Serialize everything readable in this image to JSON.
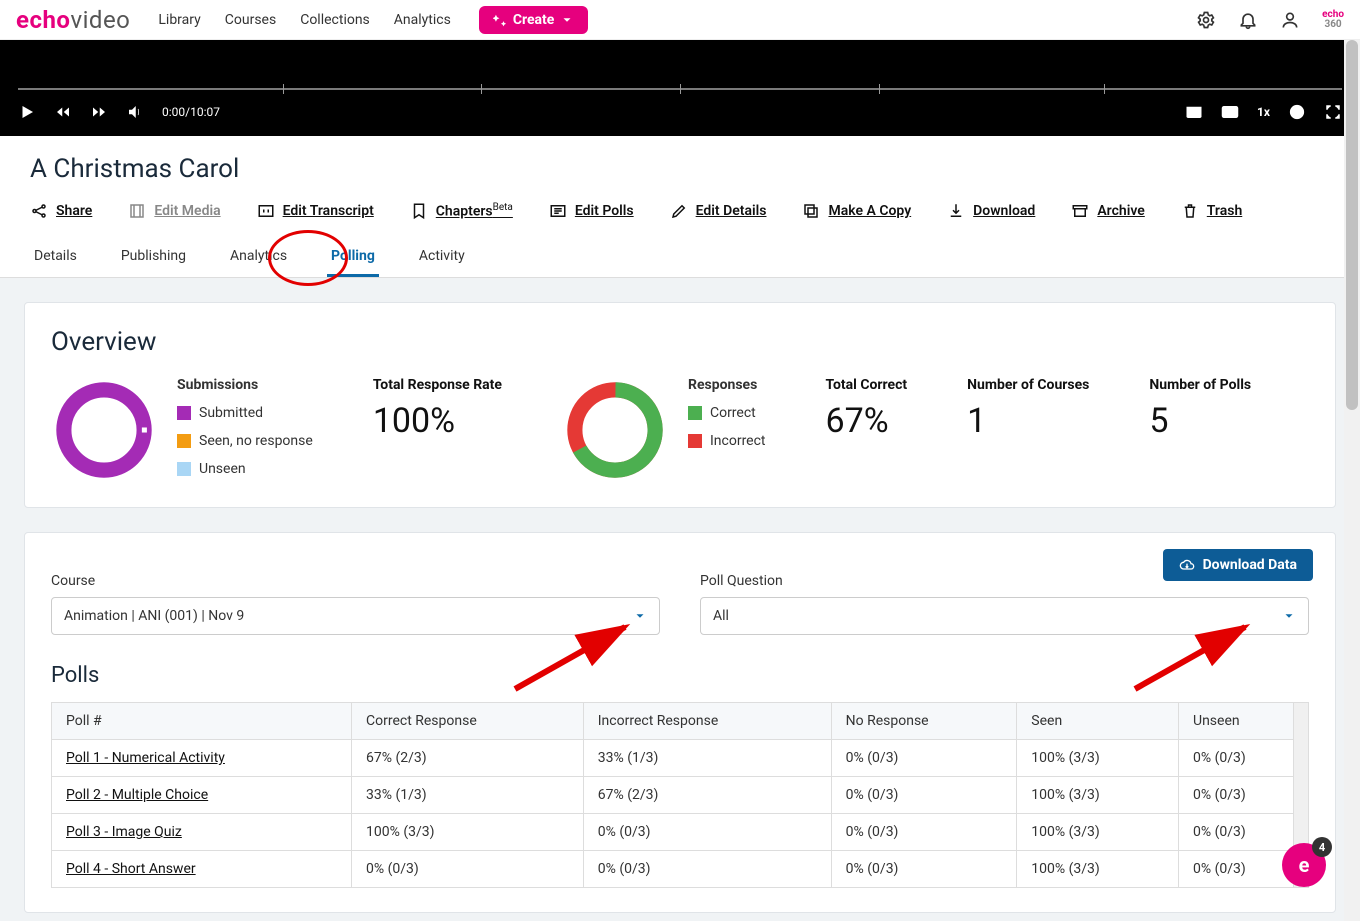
{
  "brand": {
    "name_a": "echo",
    "name_b": "video",
    "mini_a": "echo",
    "mini_b": "360"
  },
  "topnav": {
    "library": "Library",
    "courses": "Courses",
    "collections": "Collections",
    "analytics": "Analytics",
    "create": "Create"
  },
  "player": {
    "time": "0:00/10:07",
    "speed": "1x"
  },
  "title": "A Christmas Carol",
  "toolbar": {
    "share": "Share",
    "edit_media": "Edit Media",
    "edit_transcript": "Edit Transcript",
    "chapters": "Chapters",
    "beta": "Beta",
    "edit_polls": "Edit Polls",
    "edit_details": "Edit Details",
    "make_copy": "Make A Copy",
    "download": "Download",
    "archive": "Archive",
    "trash": "Trash"
  },
  "subtabs": {
    "details": "Details",
    "publishing": "Publishing",
    "analytics": "Analytics",
    "polling": "Polling",
    "activity": "Activity"
  },
  "overview": {
    "title": "Overview",
    "submissions": {
      "title": "Submissions",
      "submitted": "Submitted",
      "seen": "Seen, no response",
      "unseen": "Unseen"
    },
    "response_rate": {
      "title": "Total Response Rate",
      "value": "100%"
    },
    "responses": {
      "title": "Responses",
      "correct": "Correct",
      "incorrect": "Incorrect"
    },
    "total_correct": {
      "title": "Total Correct",
      "value": "67%"
    },
    "num_courses": {
      "title": "Number of Courses",
      "value": "1"
    },
    "num_polls": {
      "title": "Number of Polls",
      "value": "5"
    }
  },
  "chart_data": [
    {
      "type": "pie",
      "title": "Submissions",
      "categories": [
        "Submitted",
        "Seen, no response",
        "Unseen"
      ],
      "values": [
        100,
        0,
        0
      ],
      "colors": [
        "#a42bb5",
        "#f39c12",
        "#a9d6f5"
      ]
    },
    {
      "type": "pie",
      "title": "Responses",
      "categories": [
        "Correct",
        "Incorrect"
      ],
      "values": [
        67,
        33
      ],
      "colors": [
        "#4caf50",
        "#e53935"
      ]
    }
  ],
  "filters": {
    "course_label": "Course",
    "course_value": "Animation | ANI (001) | Nov 9",
    "poll_label": "Poll Question",
    "poll_value": "All",
    "download": "Download Data"
  },
  "polls": {
    "title": "Polls",
    "headers": {
      "c0": "Poll #",
      "c1": "Correct Response",
      "c2": "Incorrect Response",
      "c3": "No Response",
      "c4": "Seen",
      "c5": "Unseen"
    },
    "rows": [
      {
        "name": "Poll 1 - Numerical Activity",
        "correct": "67% (2/3)",
        "incorrect": "33% (1/3)",
        "noresp": "0% (0/3)",
        "seen": "100% (3/3)",
        "unseen": "0% (0/3)"
      },
      {
        "name": "Poll 2 - Multiple Choice",
        "correct": "33% (1/3)",
        "incorrect": "67% (2/3)",
        "noresp": "0% (0/3)",
        "seen": "100% (3/3)",
        "unseen": "0% (0/3)"
      },
      {
        "name": "Poll 3 - Image Quiz",
        "correct": "100% (3/3)",
        "incorrect": "0% (0/3)",
        "noresp": "0% (0/3)",
        "seen": "100% (3/3)",
        "unseen": "0% (0/3)"
      },
      {
        "name": "Poll 4 - Short Answer",
        "correct": "0% (0/3)",
        "incorrect": "0% (0/3)",
        "noresp": "0% (0/3)",
        "seen": "100% (3/3)",
        "unseen": "0% (0/3)"
      }
    ]
  },
  "chat_badge": "4"
}
